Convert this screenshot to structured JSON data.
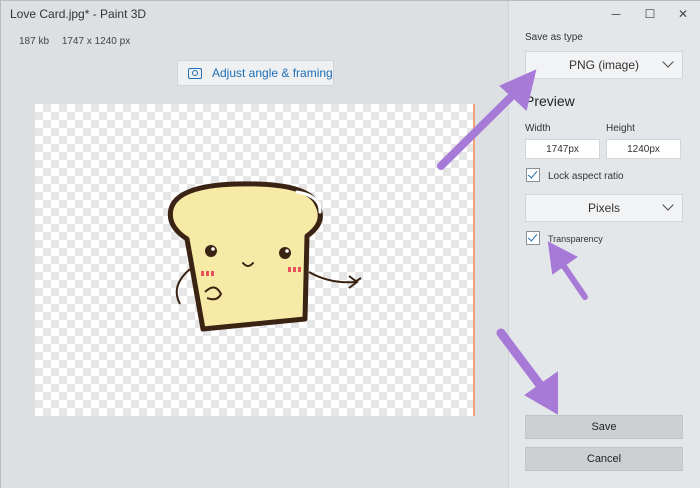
{
  "window": {
    "title": "Love Card.jpg* - Paint 3D",
    "controls": {
      "minimize": "─",
      "maximize": "☐",
      "close": "✕"
    }
  },
  "image_info": {
    "size": "187 kb",
    "dimensions": "1747 x 1240 px"
  },
  "adjust_button": {
    "label": "Adjust angle & framing",
    "icon": "camera-icon"
  },
  "panel": {
    "save_as_type_label": "Save as type",
    "save_as_type_value": "PNG (image)",
    "preview_heading": "Preview",
    "width_label": "Width",
    "width_value": "1747px",
    "height_label": "Height",
    "height_value": "1240px",
    "lock_aspect_label": "Lock aspect ratio",
    "lock_aspect_checked": true,
    "units_value": "Pixels",
    "transparency_label": "Transparency",
    "transparency_checked": true,
    "save_label": "Save",
    "cancel_label": "Cancel"
  },
  "colors": {
    "accent": "#1f6fb5",
    "annotation_arrow": "#a87ad8",
    "canvas_edge": "#f2a27a",
    "bread": "#f7eaa6",
    "bread_outline": "#3b2314"
  }
}
